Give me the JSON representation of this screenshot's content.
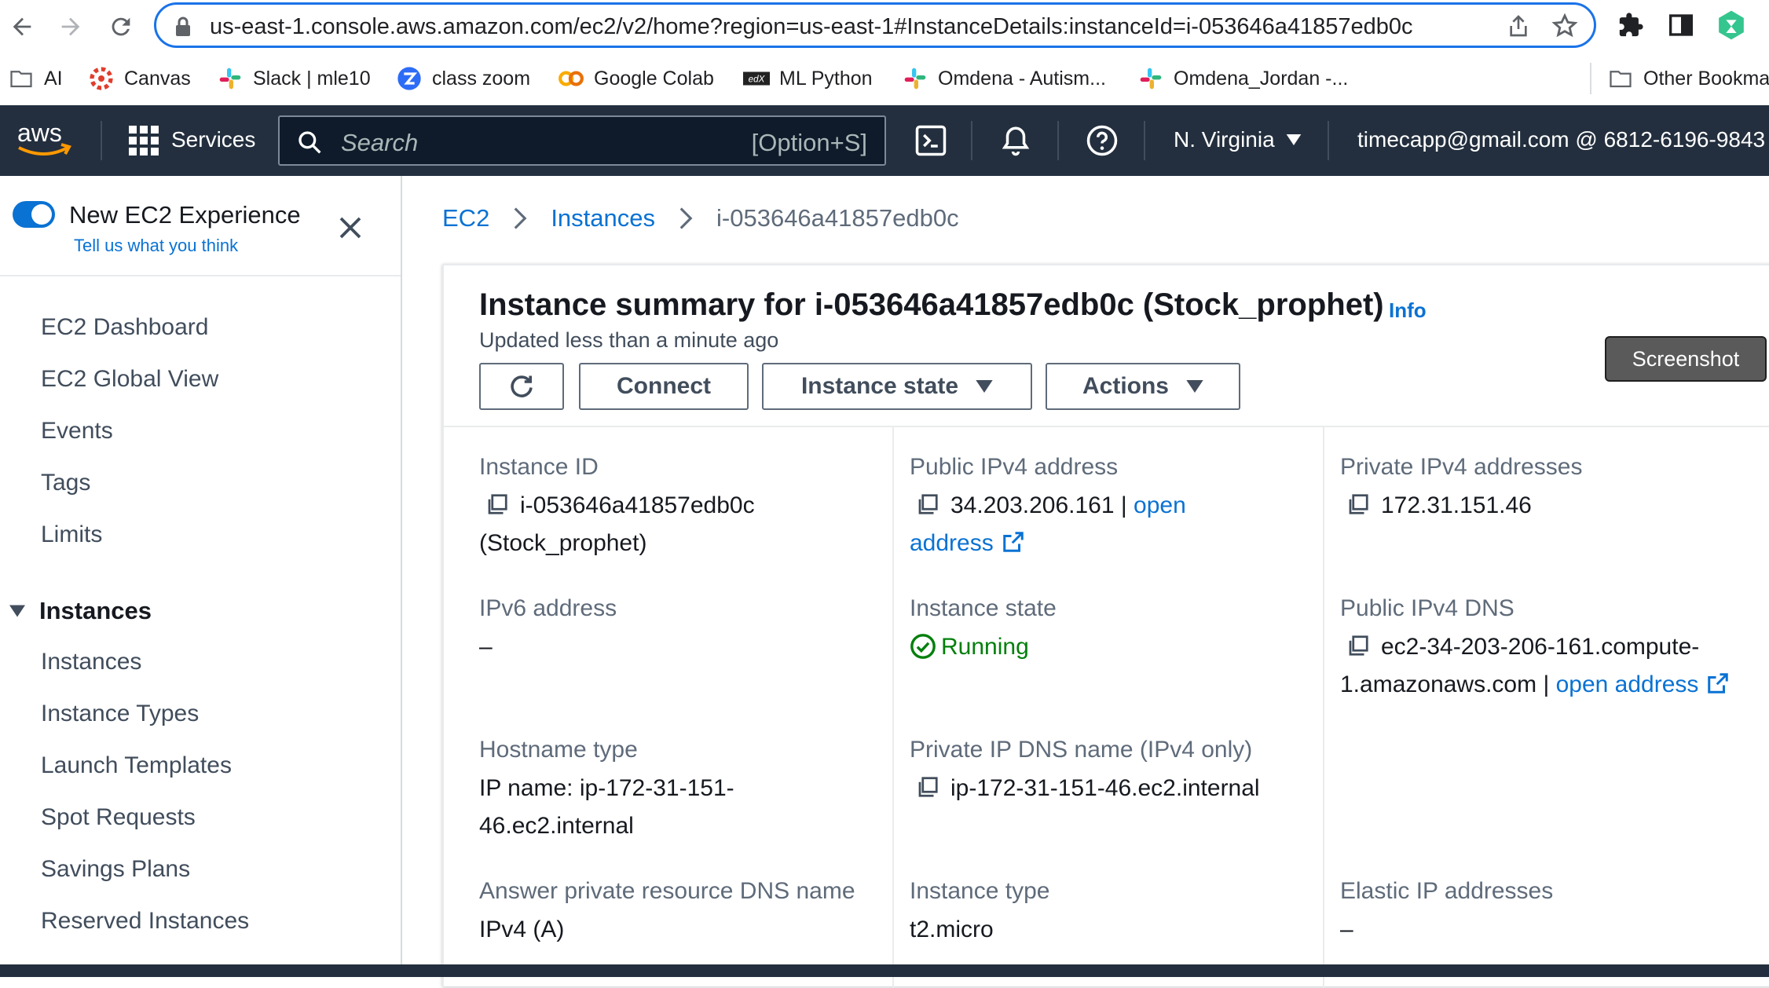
{
  "browser": {
    "url": "us-east-1.console.aws.amazon.com/ec2/v2/home?region=us-east-1#InstanceDetails:instanceId=i-053646a41857edb0c"
  },
  "bookmarks": [
    {
      "label": "AI",
      "icon": "folder-icon"
    },
    {
      "label": "Canvas",
      "icon": "canvas-icon"
    },
    {
      "label": "Slack | mle10",
      "icon": "slack-icon"
    },
    {
      "label": "class zoom",
      "icon": "zoom-icon"
    },
    {
      "label": "Google Colab",
      "icon": "colab-icon"
    },
    {
      "label": "ML Python",
      "icon": "edx-icon"
    },
    {
      "label": "Omdena - Autism...",
      "icon": "slack-icon"
    },
    {
      "label": "Omdena_Jordan -...",
      "icon": "slack-icon"
    },
    {
      "label": "Other Bookmarks",
      "icon": "folder-icon"
    }
  ],
  "aws_nav": {
    "services": "Services",
    "search_placeholder": "Search",
    "search_shortcut": "[Option+S]",
    "region": "N. Virginia",
    "account": "timecapp@gmail.com @ 6812-6196-9843"
  },
  "sidebar": {
    "experience_title": "New EC2 Experience",
    "experience_link": "Tell us what you think",
    "items": [
      "EC2 Dashboard",
      "EC2 Global View",
      "Events",
      "Tags",
      "Limits"
    ],
    "section": "Instances",
    "section_items": [
      "Instances",
      "Instance Types",
      "Launch Templates",
      "Spot Requests",
      "Savings Plans",
      "Reserved Instances"
    ]
  },
  "breadcrumb": [
    "EC2",
    "Instances",
    "i-053646a41857edb0c"
  ],
  "summary": {
    "title": "Instance summary for i-053646a41857edb0c (Stock_prophet)",
    "info": "Info",
    "updated": "Updated less than a minute ago",
    "buttons": {
      "connect": "Connect",
      "instance_state": "Instance state",
      "actions": "Actions"
    },
    "screenshot": "Screenshot"
  },
  "fields": {
    "instance_id": {
      "label": "Instance ID",
      "value1": "i-053646a41857edb0c",
      "value2": "(Stock_prophet)"
    },
    "public_ipv4": {
      "label": "Public IPv4 address",
      "value": "34.203.206.161",
      "sep": "|",
      "link1": "open",
      "link2": "address"
    },
    "private_ipv4": {
      "label": "Private IPv4 addresses",
      "value": "172.31.151.46"
    },
    "ipv6": {
      "label": "IPv6 address",
      "value": "–"
    },
    "instance_state": {
      "label": "Instance state",
      "value": "Running"
    },
    "public_dns": {
      "label": "Public IPv4 DNS",
      "value1": "ec2-34-203-206-161.compute-",
      "value2": "1.amazonaws.com",
      "sep": "|",
      "link": "open address"
    },
    "hostname_type": {
      "label": "Hostname type",
      "value1": "IP name: ip-172-31-151-",
      "value2": "46.ec2.internal"
    },
    "private_dns": {
      "label": "Private IP DNS name (IPv4 only)",
      "value": "ip-172-31-151-46.ec2.internal"
    },
    "answer_dns": {
      "label": "Answer private resource DNS name",
      "value": "IPv4 (A)"
    },
    "instance_type": {
      "label": "Instance type",
      "value": "t2.micro"
    },
    "elastic_ip": {
      "label": "Elastic IP addresses",
      "value": "–"
    }
  },
  "colors": {
    "aws_nav": "#232f3e",
    "link": "#0972d3",
    "running": "#037f0c",
    "url_focus": "#1a73e8"
  }
}
